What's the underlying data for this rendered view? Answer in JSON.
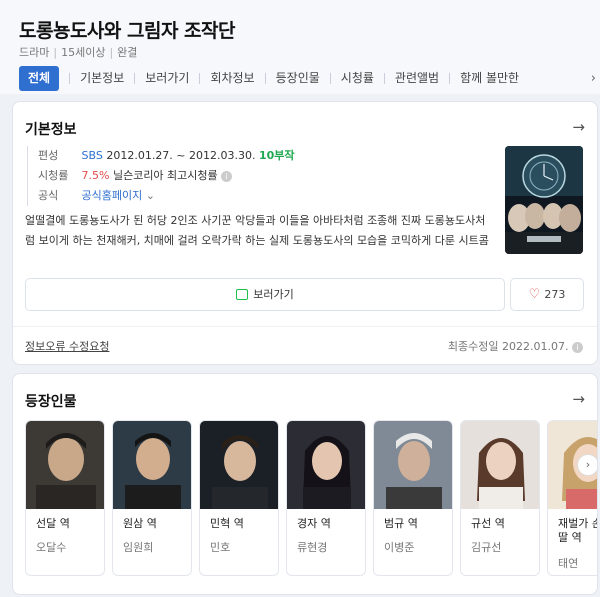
{
  "header": {
    "title": "도롱뇽도사와 그림자 조작단",
    "genre": "드라마",
    "rating": "15세이상",
    "status": "완결"
  },
  "tabs": [
    "전체",
    "기본정보",
    "보러가기",
    "회차정보",
    "등장인물",
    "시청률",
    "관련앨범",
    "함께 볼만한"
  ],
  "basic_info": {
    "title": "기본정보",
    "broadcast_label": "편성",
    "channel": "SBS",
    "period": "2012.01.27. ~ 2012.03.30.",
    "episodes": "10부작",
    "ratings_label": "시청률",
    "ratings_value": "7.5%",
    "ratings_source": "닐슨코리아 최고시청률",
    "official_label": "공식",
    "official_link": "공식홈페이지",
    "description": "얼떨결에 도롱뇽도사가 된 허당 2인조 사기꾼 악당들과 이들을 아바타처럼 조종해 진짜 도롱뇽도사처럼 보이게 하는 천재해커, 치매에 걸려 오락가락 하는 실제 도롱뇽도사의 모습을 코믹하게 다룬 시트콤",
    "watch_label": "보러가기",
    "like_count": "273",
    "report_link": "정보오류 수정요청",
    "updated": "최종수정일 2022.01.07."
  },
  "cast_section": {
    "title": "등장인물",
    "members": [
      {
        "role": "선달 역",
        "actor": "오달수"
      },
      {
        "role": "원삼 역",
        "actor": "임원희"
      },
      {
        "role": "민혁 역",
        "actor": "민호"
      },
      {
        "role": "경자 역",
        "actor": "류현경"
      },
      {
        "role": "범규 역",
        "actor": "이병준"
      },
      {
        "role": "규선 역",
        "actor": "김규선"
      },
      {
        "role": "재벌가 손녀딸 역",
        "actor": "태연"
      }
    ]
  },
  "colors": {
    "accent": "#2f6fd0",
    "green": "#1ea84f",
    "red": "#e24b4b"
  }
}
